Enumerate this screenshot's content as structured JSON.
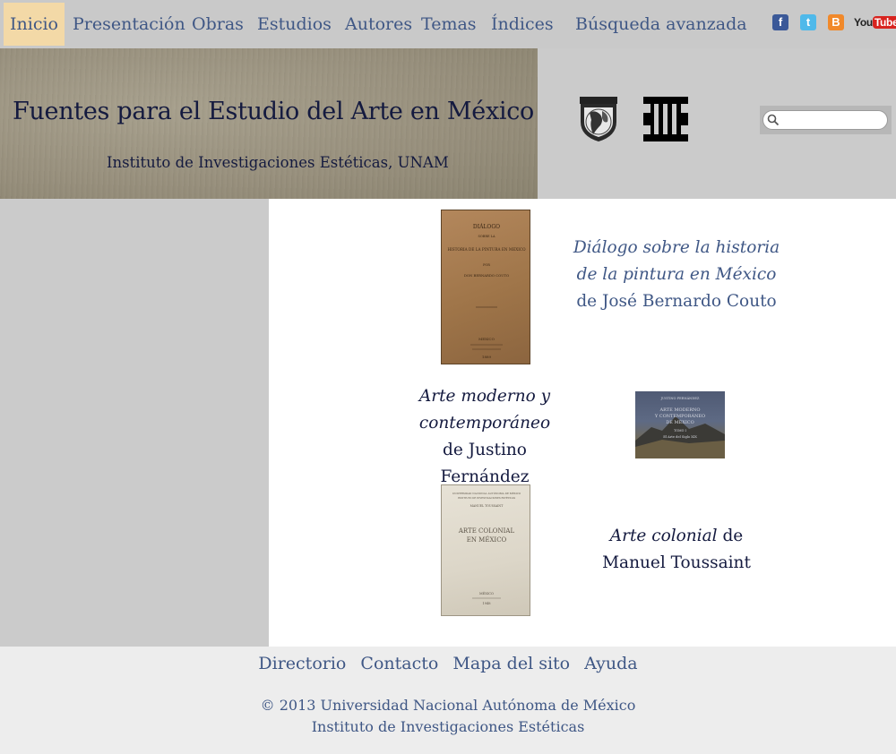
{
  "nav": {
    "items": [
      {
        "label": "Inicio",
        "active": true
      },
      {
        "label": "Presentación"
      },
      {
        "label": "Obras"
      },
      {
        "label": "Estudios"
      },
      {
        "label": "Autores"
      },
      {
        "label": "Temas"
      },
      {
        "label": "Índices"
      },
      {
        "label": "Búsqueda avanzada"
      }
    ],
    "social": {
      "facebook": "f",
      "twitter": "t",
      "blogger": "B",
      "youtube_you": "You",
      "youtube_tube": "Tube"
    }
  },
  "header": {
    "title": "Fuentes para el Estudio del Arte en México",
    "subtitle": "Instituto de Investigaciones Estéticas, UNAM",
    "search_placeholder": ""
  },
  "books": [
    {
      "title_italic": "Diálogo sobre la historia de la pintura en México",
      "connector": " de ",
      "author": "José Bernardo Couto",
      "cover_lines": [
        "DIÁLOGO",
        "SOBRE LA",
        "HISTORIA DE LA PINTURA EN MEXICO",
        "POR",
        "DON BERNARDO COUTO",
        "MEXICO",
        "1889"
      ]
    },
    {
      "title_italic": "Arte moderno y contemporáneo",
      "connector": " de ",
      "author": "Justino Fernández",
      "cover_lines": [
        "JUSTINO FERNÁNDEZ",
        "ARTE MODERNO",
        "Y CONTEMPORÁNEO",
        "DE MÉXICO",
        "TOMO I",
        "El Arte del Siglo XIX"
      ]
    },
    {
      "title_italic": "Arte colonial",
      "connector": " de ",
      "author": "Manuel Toussaint",
      "cover_lines": [
        "UNIVERSIDAD NACIONAL AUTÓNOMA DE MÉXICO",
        "INSTITUTO DE INVESTIGACIONES ESTÉTICAS",
        "MANUEL TOUSSAINT",
        "ARTE COLONIAL",
        "EN MÉXICO",
        "MÉXICO",
        "1948"
      ]
    }
  ],
  "footer": {
    "links": [
      "Directorio",
      "Contacto",
      "Mapa del sito",
      "Ayuda"
    ],
    "copyright": "© 2013 Universidad Nacional Autónoma de México",
    "institute": "Instituto de Investigaciones Estéticas"
  },
  "colors": {
    "link": "#3f5785",
    "dark_text": "#141a3f",
    "active_tab": "#f3d9a7",
    "gray_bg": "#cbcbcb",
    "footer_bg": "#ededed"
  }
}
